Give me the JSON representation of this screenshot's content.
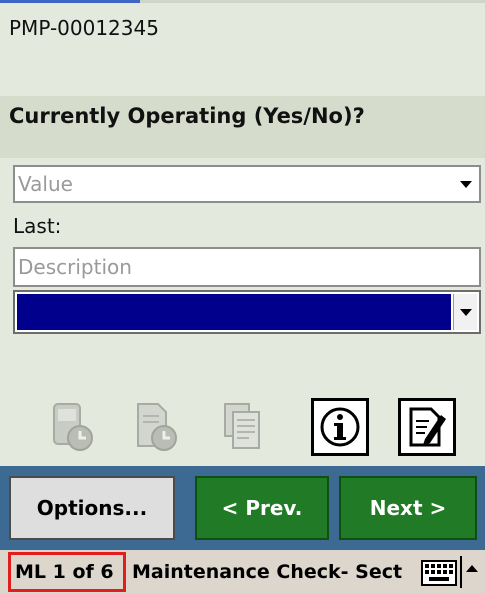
{
  "asset_id": "PMP-00012345",
  "question": "Currently Operating (Yes/No)?",
  "value_field": {
    "placeholder": "Value"
  },
  "last_label": "Last:",
  "description_field": {
    "placeholder": "Description"
  },
  "toolbar": {
    "icons": [
      "device-history-icon",
      "document-history-icon",
      "forms-icon",
      "info-icon",
      "edit-notes-icon"
    ]
  },
  "buttons": {
    "options": "Options...",
    "prev": "< Prev.",
    "next": "Next >"
  },
  "status": {
    "page_indicator": "ML 1 of 6",
    "section_title": "Maintenance Check- Sect"
  },
  "colors": {
    "background": "#e4e9dd",
    "button_bar": "#3c6a93",
    "nav_green": "#217a25",
    "selected_blue": "#00008c",
    "highlight_red": "#e11d1d"
  }
}
